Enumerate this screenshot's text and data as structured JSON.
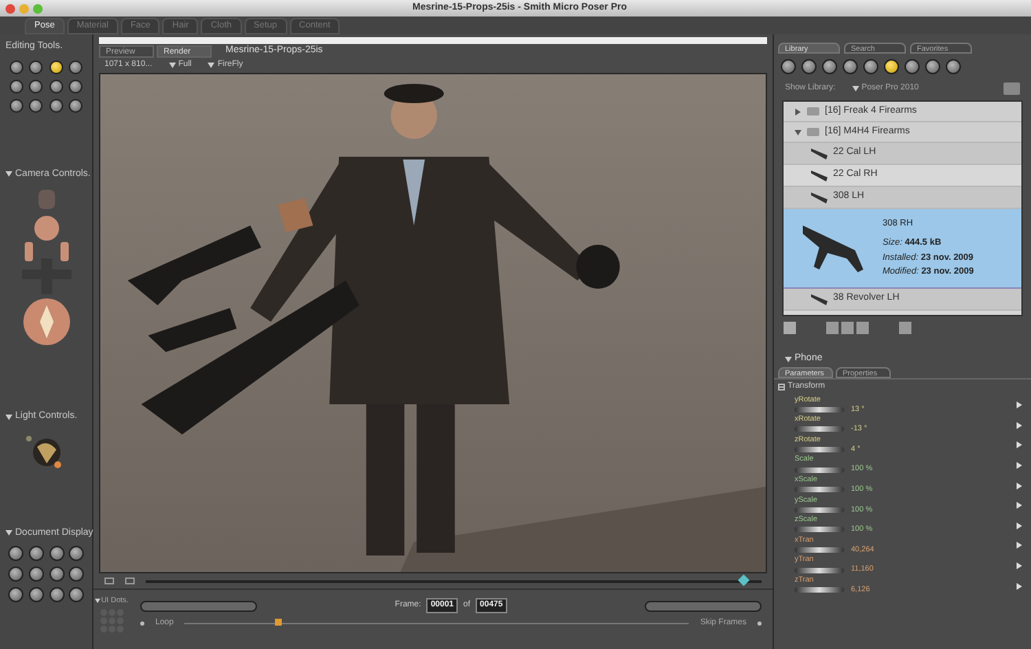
{
  "window": {
    "title": "Mesrine-15-Props-25is - Smith Micro Poser Pro"
  },
  "rooms": [
    {
      "label": "Pose",
      "selected": true
    },
    {
      "label": "Material",
      "selected": false
    },
    {
      "label": "Face",
      "selected": false
    },
    {
      "label": "Hair",
      "selected": false
    },
    {
      "label": "Cloth",
      "selected": false
    },
    {
      "label": "Setup",
      "selected": false
    },
    {
      "label": "Content",
      "selected": false
    }
  ],
  "editing_tools": {
    "title": "Editing Tools.",
    "tools": [
      {
        "selected": false
      },
      {
        "selected": false
      },
      {
        "selected": true
      },
      {
        "selected": false
      },
      {
        "selected": false
      },
      {
        "selected": false
      },
      {
        "selected": false
      },
      {
        "selected": false
      },
      {
        "selected": false
      },
      {
        "selected": false
      },
      {
        "selected": false
      },
      {
        "selected": false
      }
    ]
  },
  "camera_controls": {
    "title": "Camera Controls."
  },
  "light_controls": {
    "title": "Light Controls."
  },
  "document_display": {
    "title": "Document Display"
  },
  "ui_dots": {
    "title": "UI Dots."
  },
  "document": {
    "tabs": [
      {
        "label": "Preview",
        "selected": false
      },
      {
        "label": "Render",
        "selected": true
      }
    ],
    "title": "Mesrine-15-Props-25is",
    "size": "1071 x 810...",
    "display": "Full",
    "renderer": "FireFly"
  },
  "timeline": {
    "level": 0.97
  },
  "playback": {
    "frame_label": "Frame:",
    "frame": "00001",
    "of": "of",
    "total": "00475",
    "loop": "Loop",
    "skip_frames": "Skip Frames",
    "level": 0.18
  },
  "library": {
    "tabs": [
      {
        "label": "Library",
        "selected": true
      },
      {
        "label": "Search",
        "selected": false
      },
      {
        "label": "Favorites",
        "selected": false
      }
    ],
    "categories": [
      {
        "selected": false
      },
      {
        "selected": false
      },
      {
        "selected": false
      },
      {
        "selected": false
      },
      {
        "selected": false
      },
      {
        "selected": true
      },
      {
        "selected": false
      },
      {
        "selected": false
      },
      {
        "selected": false
      }
    ],
    "show_label": "Show Library:",
    "source": "Poser Pro 2010",
    "items": [
      {
        "count": "[16]",
        "name": "Freak 4 Firearms",
        "expanded": false
      },
      {
        "count": "[16]",
        "name": "M4H4 Firearms",
        "expanded": true,
        "children": [
          {
            "name": "22 Cal LH",
            "selected": false
          },
          {
            "name": "22 Cal RH",
            "selected": false
          },
          {
            "name": "308 LH",
            "selected": false
          },
          {
            "name": "308 RH",
            "selected": true,
            "details": [
              {
                "label": "Size:",
                "value": "444.5 kB"
              },
              {
                "label": "Installed:",
                "value": "23 nov. 2009"
              },
              {
                "label": "Modified:",
                "value": "23 nov. 2009"
              }
            ]
          },
          {
            "name": "38 Revolver LH",
            "selected": false
          }
        ]
      }
    ]
  },
  "parameters": {
    "figure": "Phone",
    "tabs": [
      {
        "label": "Parameters",
        "selected": true
      },
      {
        "label": "Properties",
        "selected": false
      }
    ],
    "group": "Transform",
    "expanded": true,
    "params": [
      {
        "name": "yRotate",
        "value": "13 °",
        "color": "#d8d08a"
      },
      {
        "name": "xRotate",
        "value": "-13 °",
        "color": "#d8d08a"
      },
      {
        "name": "zRotate",
        "value": "4 °",
        "color": "#d8d08a"
      },
      {
        "name": "Scale",
        "value": "100 %",
        "color": "#9cc890"
      },
      {
        "name": "xScale",
        "value": "100 %",
        "color": "#9cc890"
      },
      {
        "name": "yScale",
        "value": "100 %",
        "color": "#9cc890"
      },
      {
        "name": "zScale",
        "value": "100 %",
        "color": "#9cc890"
      },
      {
        "name": "xTran",
        "value": "40,264",
        "color": "#d8a070"
      },
      {
        "name": "yTran",
        "value": "11,160",
        "color": "#d8a070"
      },
      {
        "name": "zTran",
        "value": "6,126",
        "color": "#d8a070"
      }
    ]
  }
}
